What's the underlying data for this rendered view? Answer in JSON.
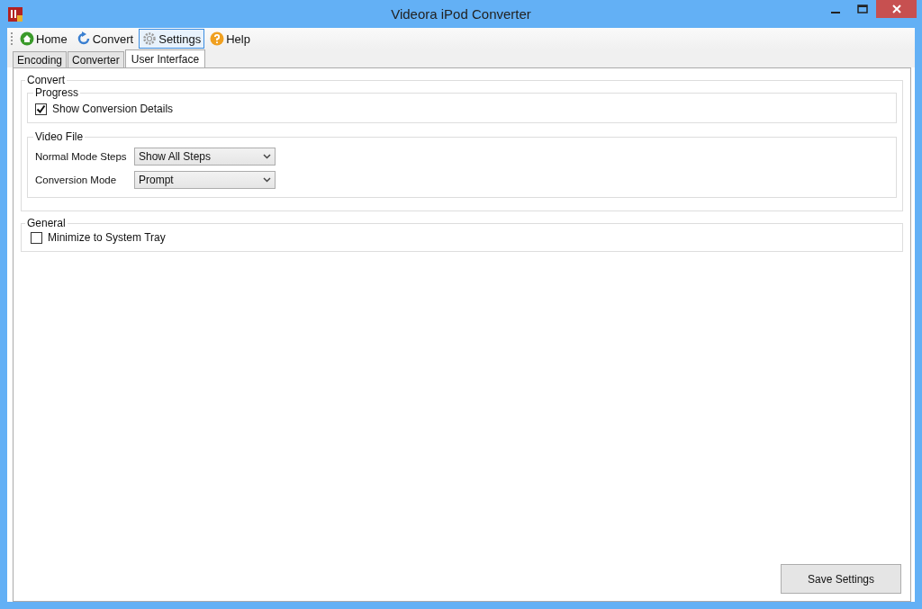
{
  "window": {
    "title": "Videora iPod Converter"
  },
  "toolbar": [
    {
      "label": "Home",
      "kind": "home",
      "selected": false
    },
    {
      "label": "Convert",
      "kind": "refresh",
      "selected": false
    },
    {
      "label": "Settings",
      "kind": "gear",
      "selected": true
    },
    {
      "label": "Help",
      "kind": "help",
      "selected": false
    }
  ],
  "tabs": [
    {
      "label": "Encoding",
      "selected": false
    },
    {
      "label": "Converter",
      "selected": false
    },
    {
      "label": "User Interface",
      "selected": true
    }
  ],
  "groups": [
    {
      "title": "Convert",
      "groups": [
        {
          "title": "Progress",
          "rows": [
            {
              "kind": "checkbox",
              "label": "Show Conversion Details",
              "checked": true
            }
          ]
        },
        {
          "title": "Video File",
          "rows": [
            {
              "kind": "dropdown",
              "label": "Normal Mode Steps",
              "value": "Show All Steps"
            },
            {
              "kind": "dropdown",
              "label": "Conversion Mode",
              "value": "Prompt"
            }
          ]
        }
      ]
    },
    {
      "title": "General",
      "rows": [
        {
          "kind": "checkbox",
          "label": "Minimize to System Tray",
          "checked": false
        }
      ]
    }
  ],
  "save_button": "Save Settings"
}
